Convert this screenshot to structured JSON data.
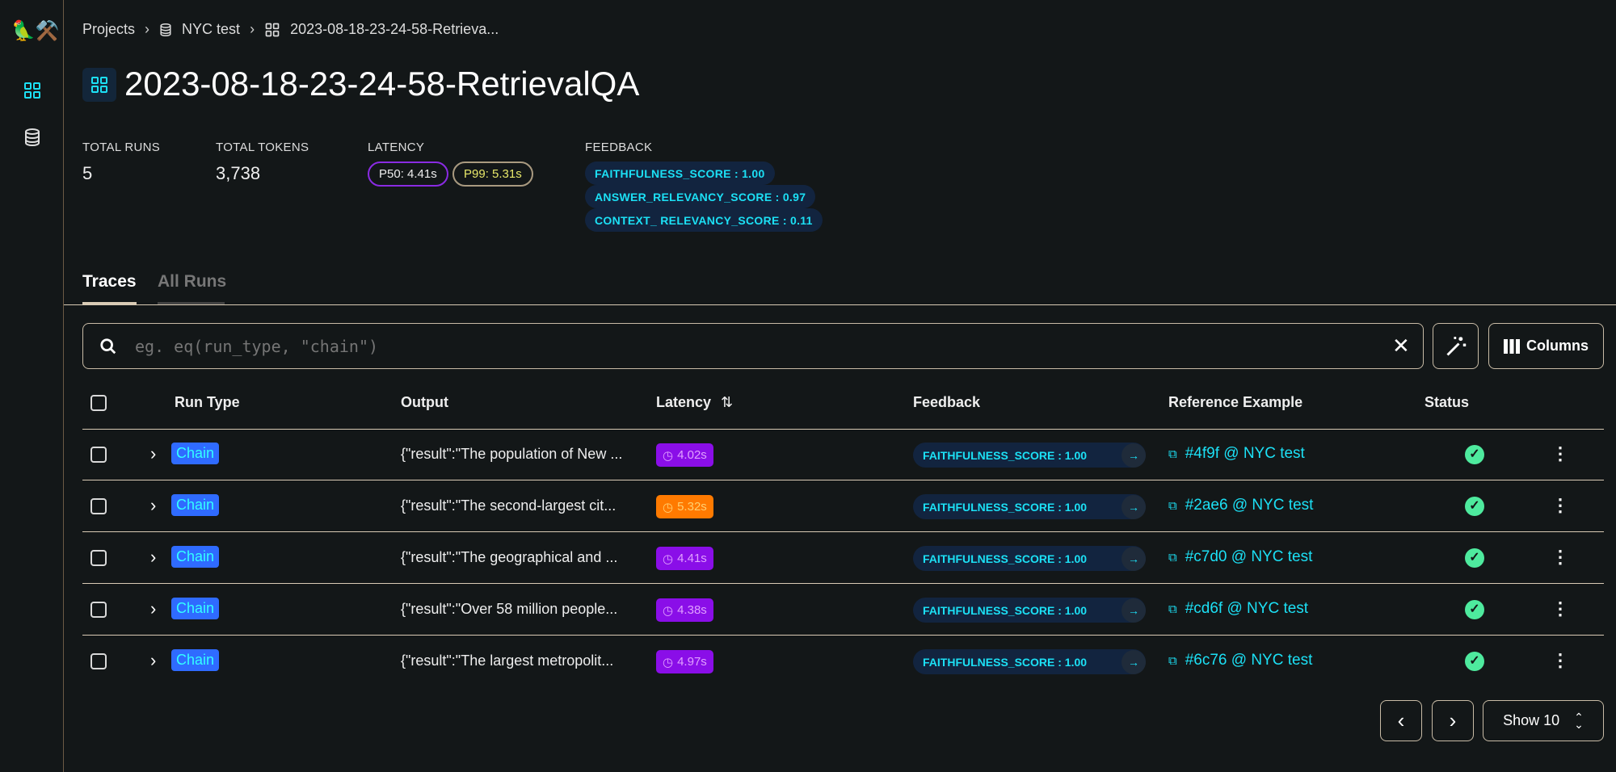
{
  "logo": "🦜⚒️",
  "breadcrumb": [
    "Projects",
    "NYC test",
    "2023-08-18-23-24-58-Retrieva..."
  ],
  "title": "2023-08-18-23-24-58-RetrievalQA",
  "stats": {
    "total_runs_label": "TOTAL RUNS",
    "total_runs": "5",
    "total_tokens_label": "TOTAL TOKENS",
    "total_tokens": "3,738",
    "latency_label": "LATENCY",
    "p50": "P50: 4.41s",
    "p99": "P99: 5.31s",
    "feedback_label": "FEEDBACK",
    "feedback": [
      "FAITHFULNESS_SCORE : 1.00",
      "ANSWER_RELEVANCY_SCORE : 0.97",
      "CONTEXT_ RELEVANCY_SCORE : 0.11"
    ]
  },
  "tabs": [
    {
      "label": "Traces",
      "active": true
    },
    {
      "label": "All Runs",
      "active": false
    }
  ],
  "search": {
    "placeholder": "eg. eq(run_type, \"chain\")"
  },
  "columns_button": "Columns",
  "headers": [
    "Run Type",
    "Output",
    "Latency",
    "Feedback",
    "Reference Example",
    "Status"
  ],
  "colors": {
    "latency_normal": "#8a0ee8",
    "latency_slow": "#ff7a00",
    "chain": "#2f6bff",
    "accent": "#1ce0f5",
    "status_ok": "#4eea9e"
  },
  "rows": [
    {
      "run_type": "Chain",
      "output": "{\"result\":\"The population of New ...",
      "latency": "4.02s",
      "slow": false,
      "feedback": "FAITHFULNESS_SCORE : 1.00",
      "reference": "#4f9f @ NYC test",
      "status": "success"
    },
    {
      "run_type": "Chain",
      "output": "{\"result\":\"The second-largest cit...",
      "latency": "5.32s",
      "slow": true,
      "feedback": "FAITHFULNESS_SCORE : 1.00",
      "reference": "#2ae6 @ NYC test",
      "status": "success"
    },
    {
      "run_type": "Chain",
      "output": "{\"result\":\"The geographical and ...",
      "latency": "4.41s",
      "slow": false,
      "feedback": "FAITHFULNESS_SCORE : 1.00",
      "reference": "#c7d0 @ NYC test",
      "status": "success"
    },
    {
      "run_type": "Chain",
      "output": "{\"result\":\"Over 58 million people...",
      "latency": "4.38s",
      "slow": false,
      "feedback": "FAITHFULNESS_SCORE : 1.00",
      "reference": "#cd6f @ NYC test",
      "status": "success"
    },
    {
      "run_type": "Chain",
      "output": "{\"result\":\"The largest metropolit...",
      "latency": "4.97s",
      "slow": false,
      "feedback": "FAITHFULNESS_SCORE : 1.00",
      "reference": "#6c76 @ NYC test",
      "status": "success"
    }
  ],
  "pagination": {
    "show": "Show 10"
  }
}
